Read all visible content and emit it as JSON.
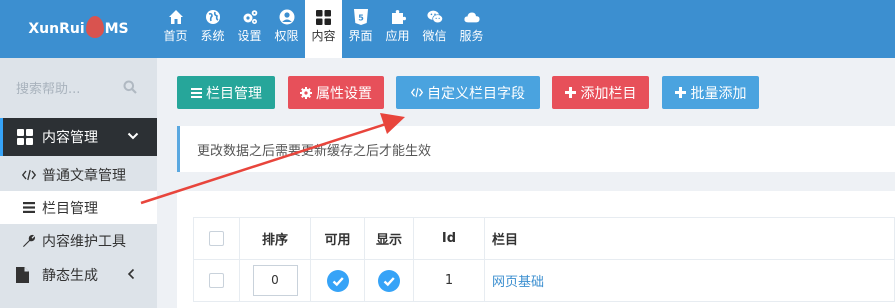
{
  "logo": {
    "text_before": "XunRui",
    "text_after": "MS"
  },
  "nav": [
    {
      "label": "首页",
      "icon": "home-icon"
    },
    {
      "label": "系统",
      "icon": "globe-icon"
    },
    {
      "label": "设置",
      "icon": "cogs-icon"
    },
    {
      "label": "权限",
      "icon": "user-circle-icon"
    },
    {
      "label": "内容",
      "icon": "grid-icon"
    },
    {
      "label": "界面",
      "icon": "html5-icon"
    },
    {
      "label": "应用",
      "icon": "puzzle-icon"
    },
    {
      "label": "微信",
      "icon": "wechat-icon"
    },
    {
      "label": "服务",
      "icon": "cloud-icon"
    }
  ],
  "sidebar": {
    "search_placeholder": "搜索帮助...",
    "section_label": "内容管理",
    "items": [
      {
        "label": "普通文章管理",
        "icon": "code-icon"
      },
      {
        "label": "栏目管理",
        "icon": "list-icon"
      },
      {
        "label": "内容维护工具",
        "icon": "wrench-icon"
      }
    ],
    "static_label": "静态生成"
  },
  "toolbar": {
    "buttons": [
      {
        "label": "栏目管理",
        "icon": "list-icon",
        "color": "#26a69a"
      },
      {
        "label": "属性设置",
        "icon": "gear-icon",
        "color": "#e7505a"
      },
      {
        "label": "自定义栏目字段",
        "icon": "code-icon",
        "color": "#4aa3df"
      },
      {
        "label": "添加栏目",
        "icon": "plus-icon",
        "color": "#e7505a"
      },
      {
        "label": "批量添加",
        "icon": "plus-icon",
        "color": "#4aa3df"
      }
    ]
  },
  "notice": "更改数据之后需要更新缓存之后才能生效",
  "table": {
    "headers": [
      "",
      "排序",
      "可用",
      "显示",
      "Id",
      "栏目"
    ],
    "rows": [
      {
        "order": "0",
        "enabled": true,
        "visible": true,
        "id": "1",
        "name": "网页基础"
      }
    ]
  },
  "colors": {
    "topbar": "#3c8fd0",
    "sidebar": "#dde3e9",
    "sidebar_head": "#2c3034",
    "accent": "#36a3f7",
    "arrow": "#e8453c"
  }
}
